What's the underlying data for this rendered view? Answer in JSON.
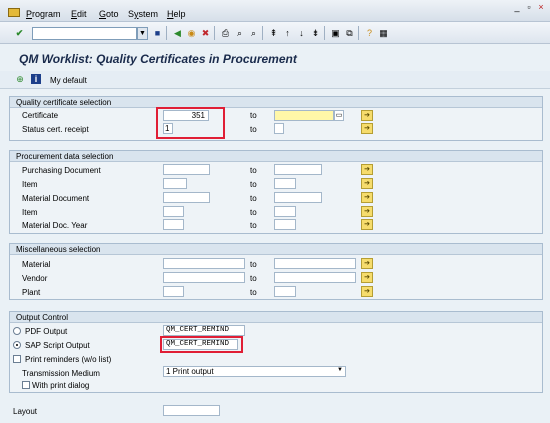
{
  "menu": {
    "items": [
      "Program",
      "Edit",
      "Goto",
      "System",
      "Help"
    ],
    "underline": [
      "P",
      "E",
      "G",
      "y",
      "H"
    ]
  },
  "title": "QM Worklist: Quality Certificates in Procurement",
  "app_toolbar": {
    "variant_label": "My default"
  },
  "sections": {
    "qc": {
      "title": "Quality certificate selection",
      "certificate_label": "Certificate",
      "certificate_value": "351",
      "status_label": "Status cert. receipt",
      "status_value": "1",
      "to": "to"
    },
    "proc": {
      "title": "Procurement data selection",
      "rows": [
        "Purchasing Document",
        "Item",
        "Material Document",
        "Item",
        "Material Doc. Year"
      ],
      "to": "to"
    },
    "misc": {
      "title": "Miscellaneous selection",
      "rows": [
        "Material",
        "Vendor",
        "Plant"
      ],
      "to": "to"
    },
    "output": {
      "title": "Output Control",
      "pdf_label": "PDF Output",
      "pdf_value": "QM_CERT_REMIND",
      "sap_label": "SAP Script Output",
      "sap_value": "QM_CERT_REMIND",
      "print_reminders_label": "Print reminders (w/o list)",
      "transmission_label": "Transmission Medium",
      "transmission_value": "1 Print output",
      "print_dialog_label": "With print dialog"
    }
  },
  "layout_label": "Layout",
  "colors": {
    "highlight": "#e01e35",
    "required_field": "#fff7a8",
    "arrow_button": "#f6dc6c"
  }
}
